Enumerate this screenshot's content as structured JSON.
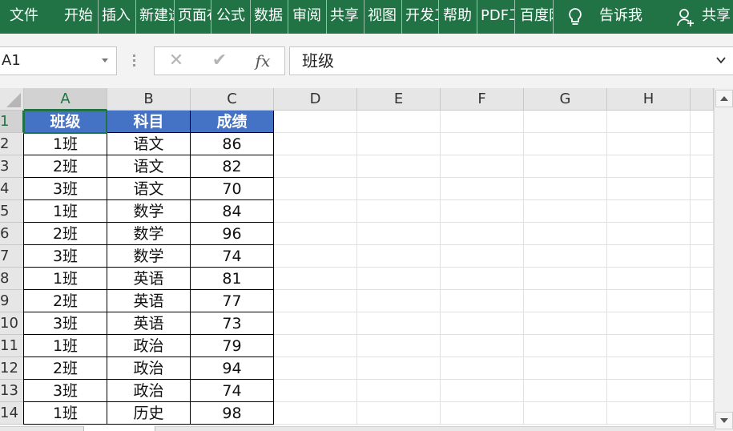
{
  "ribbon": {
    "tabs": [
      "文件",
      "开始",
      "插入",
      "新建选项卡",
      "页面布局",
      "公式",
      "数据",
      "审阅",
      "共享",
      "视图",
      "开发工具",
      "帮助",
      "PDF工具集",
      "百度网盘"
    ],
    "tell_me": "告诉我",
    "share": "共享"
  },
  "formula_bar": {
    "name_box": "A1",
    "cancel": "✕",
    "enter": "✔",
    "fx": "fx",
    "content": "班级"
  },
  "columns": [
    "A",
    "B",
    "C",
    "D",
    "E",
    "F",
    "G",
    "H"
  ],
  "rows": [
    "1",
    "2",
    "3",
    "4",
    "5",
    "6",
    "7",
    "8",
    "9",
    "10",
    "11",
    "12",
    "13",
    "14"
  ],
  "table": {
    "header": [
      "班级",
      "科目",
      "成绩"
    ],
    "rows": [
      [
        "1班",
        "语文",
        "86"
      ],
      [
        "2班",
        "语文",
        "82"
      ],
      [
        "3班",
        "语文",
        "70"
      ],
      [
        "1班",
        "数学",
        "84"
      ],
      [
        "2班",
        "数学",
        "96"
      ],
      [
        "3班",
        "数学",
        "74"
      ],
      [
        "1班",
        "英语",
        "81"
      ],
      [
        "2班",
        "英语",
        "77"
      ],
      [
        "3班",
        "英语",
        "73"
      ],
      [
        "1班",
        "政治",
        "79"
      ],
      [
        "2班",
        "政治",
        "94"
      ],
      [
        "3班",
        "政治",
        "74"
      ],
      [
        "1班",
        "历史",
        "98"
      ]
    ]
  },
  "colors": {
    "ribbon": "#217346",
    "header_fill": "#4472c4",
    "header_text": "#ffffff"
  }
}
